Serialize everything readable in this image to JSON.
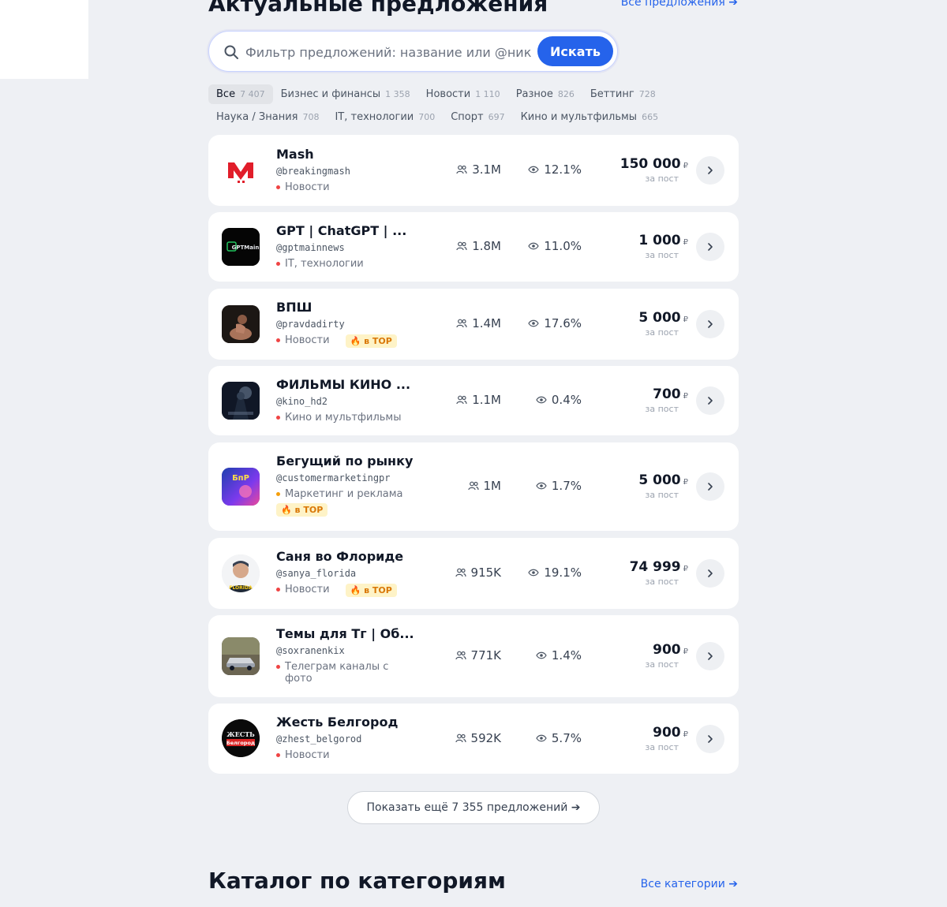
{
  "offers_section": {
    "title": "Актуальные предложения",
    "all_link": "Все предложения ➔"
  },
  "search": {
    "placeholder": "Фильтр предложений: название или @ник",
    "value": "",
    "button_label": "Искать"
  },
  "category_chips": [
    {
      "label": "Все",
      "count": "7 407",
      "active": true
    },
    {
      "label": "Бизнес и финансы",
      "count": "1 358"
    },
    {
      "label": "Новости",
      "count": "1 110"
    },
    {
      "label": "Разное",
      "count": "826"
    },
    {
      "label": "Беттинг",
      "count": "728"
    },
    {
      "label": "Наука / Знания",
      "count": "708"
    },
    {
      "label": "IT, технологии",
      "count": "700"
    },
    {
      "label": "Спорт",
      "count": "697"
    },
    {
      "label": "Кино и мультфильмы",
      "count": "665"
    }
  ],
  "offers": [
    {
      "name": "Mash",
      "handle": "@breakingmash",
      "category": "Новости",
      "subscribers": "3.1M",
      "er": "12.1%",
      "price": "150 000",
      "currency": "₽",
      "price_label": "за пост",
      "top": false,
      "avatar_icon": "mash-logo-icon"
    },
    {
      "name": "GPT | ChatGPT | ...",
      "handle": "@gptmainnews",
      "category": "IT, технологии",
      "subscribers": "1.8M",
      "er": "11.0%",
      "price": "1 000",
      "currency": "₽",
      "price_label": "за пост",
      "top": false,
      "avatar_icon": "gpt-logo-icon",
      "avatar_text": "GPTMain"
    },
    {
      "name": "ВПШ",
      "handle": "@pravdadirty",
      "category": "Новости",
      "subscribers": "1.4M",
      "er": "17.6%",
      "price": "5 000",
      "currency": "₽",
      "price_label": "за пост",
      "top": true,
      "top_label": "в TOP",
      "avatar_icon": "vpsh-photo-icon"
    },
    {
      "name": "ФИЛЬМЫ КИНО ...",
      "handle": "@kino_hd2",
      "category": "Кино и мультфильмы",
      "subscribers": "1.1M",
      "er": "0.4%",
      "price": "700",
      "currency": "₽",
      "price_label": "за пост",
      "top": false,
      "avatar_icon": "kino-poster-icon"
    },
    {
      "name": "Бегущий по рынку",
      "handle": "@customermarketingpr",
      "category": "Маркетинг и реклама",
      "subscribers": "1M",
      "er": "1.7%",
      "price": "5 000",
      "currency": "₽",
      "price_label": "за пост",
      "top": true,
      "top_label": "в TOP",
      "avatar_icon": "bpr-logo-icon",
      "avatar_text": "БпР"
    },
    {
      "name": "Саня во Флориде",
      "handle": "@sanya_florida",
      "category": "Новости",
      "subscribers": "915K",
      "er": "19.1%",
      "price": "74 999",
      "currency": "₽",
      "price_label": "за пост",
      "top": true,
      "top_label": "в TOP",
      "avatar_icon": "sanya-photo-icon",
      "avatar_text": "FLORIDA"
    },
    {
      "name": "Темы для Тг | Об...",
      "handle": "@soxranenkix",
      "category": "Телеграм каналы с фото",
      "subscribers": "771K",
      "er": "1.4%",
      "price": "900",
      "currency": "₽",
      "price_label": "за пост",
      "top": false,
      "avatar_icon": "car-photo-icon"
    },
    {
      "name": "Жесть Белгород",
      "handle": "@zhest_belgorod",
      "category": "Новости",
      "subscribers": "592K",
      "er": "5.7%",
      "price": "900",
      "currency": "₽",
      "price_label": "за пост",
      "top": false,
      "avatar_icon": "zhest-logo-icon",
      "avatar_text": "ЖЕСТЬ",
      "avatar_text2": "Белгород"
    }
  ],
  "show_more_label": "Показать ещё 7 355 предложений ➔",
  "catalog_section": {
    "title": "Каталог по категориям",
    "all_link": "Все категории ➔"
  },
  "colors": {
    "accent": "#2563eb",
    "category_dot": "#ef4444",
    "marketing_dot": "#f59e0b",
    "top_badge_bg": "#fef3c7",
    "top_badge_text": "#d97706",
    "page_bg": "#eef0f4"
  }
}
